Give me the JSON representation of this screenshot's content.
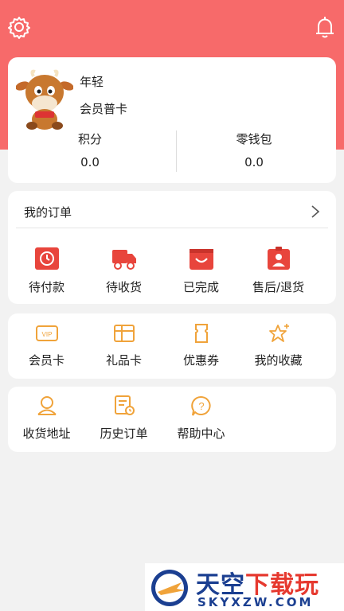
{
  "header": {
    "bg_color": "#f76a6a",
    "settings_icon": "gear-icon",
    "notify_icon": "bell-icon"
  },
  "profile": {
    "name": "年轻",
    "level": "会员普卡",
    "points_label": "积分",
    "points_value": "0.0",
    "wallet_label": "零钱包",
    "wallet_value": "0.0"
  },
  "orders": {
    "title": "我的订单",
    "items": [
      {
        "label": "待付款",
        "icon": "pending-payment-icon"
      },
      {
        "label": "待收货",
        "icon": "truck-icon"
      },
      {
        "label": "已完成",
        "icon": "completed-icon"
      },
      {
        "label": "售后/退货",
        "icon": "after-sales-icon"
      }
    ]
  },
  "cards_section": {
    "items": [
      {
        "label": "会员卡",
        "icon": "vip-card-icon"
      },
      {
        "label": "礼品卡",
        "icon": "gift-card-icon"
      },
      {
        "label": "优惠券",
        "icon": "coupon-icon"
      },
      {
        "label": "我的收藏",
        "icon": "star-icon"
      }
    ]
  },
  "service_section": {
    "items": [
      {
        "label": "收货地址",
        "icon": "address-icon"
      },
      {
        "label": "历史订单",
        "icon": "history-icon"
      },
      {
        "label": "帮助中心",
        "icon": "help-icon"
      }
    ]
  },
  "colors": {
    "accent_red": "#e8453c",
    "accent_orange": "#f0a33a"
  },
  "watermark": {
    "cn_text_a": "天空",
    "cn_text_b": "下载玩",
    "en_text": "SKYXZW.COM"
  }
}
